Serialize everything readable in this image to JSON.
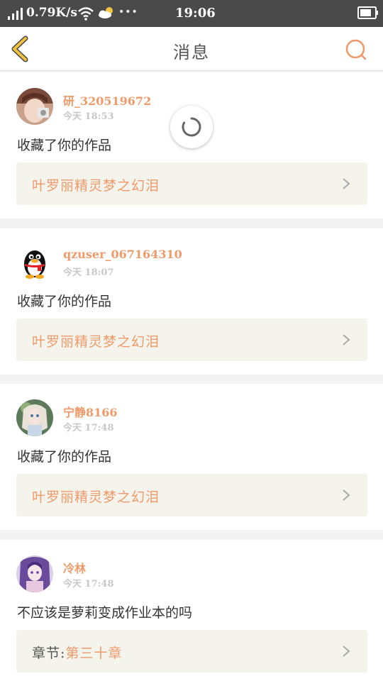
{
  "status_bar": {
    "net_speed": "0.79K/s",
    "dots": "•••",
    "time": "19:06"
  },
  "header": {
    "title": "消息"
  },
  "messages": [
    {
      "username": "研_320519672",
      "time": "今天 18:53",
      "action": "收藏了你的作品",
      "work_prefix": "",
      "work_title": "叶罗丽精灵梦之幻泪",
      "avatar_icon": "girl-photo-avatar"
    },
    {
      "username": "qzuser_067164310",
      "time": "今天 18:07",
      "action": "收藏了你的作品",
      "work_prefix": "",
      "work_title": "叶罗丽精灵梦之幻泪",
      "avatar_icon": "qq-penguin-avatar"
    },
    {
      "username": "宁静8166",
      "time": "今天 17:48",
      "action": "收藏了你的作品",
      "work_prefix": "",
      "work_title": "叶罗丽精灵梦之幻泪",
      "avatar_icon": "doll-avatar"
    },
    {
      "username": "冷林",
      "time": "今天 17:48",
      "action": "不应该是萝莉变成作业本的吗",
      "work_prefix": "章节:",
      "work_title": "第三十章",
      "avatar_icon": "anime-girl-avatar"
    }
  ],
  "colors": {
    "accent": "#ee9a6a",
    "back_arrow": "#f0c040",
    "status_bar": "#4a4a4a",
    "work_box_bg": "#f4f4ec"
  }
}
